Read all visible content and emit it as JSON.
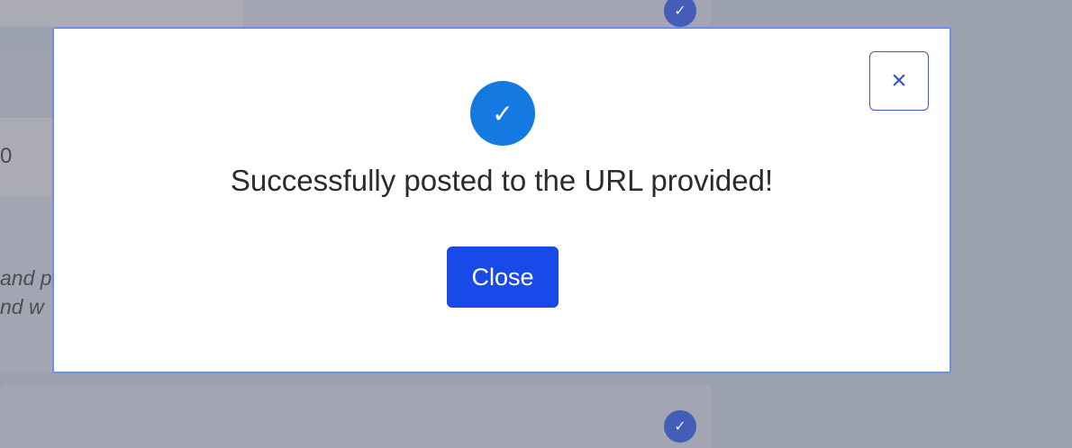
{
  "background": {
    "field_value": "0",
    "description_line_1": "and p",
    "description_line_2": "nd w",
    "check_icon": "check-icon"
  },
  "modal": {
    "close_icon": "×",
    "success_icon": "✓",
    "message": "Successfully posted to the URL provided!",
    "close_label": "Close"
  },
  "colors": {
    "overlay": "#a0a5b1",
    "modal_border": "#6a92e8",
    "success_icon": "#1479e0",
    "primary_button": "#1a49ea",
    "close_icon": "#3651c9"
  }
}
